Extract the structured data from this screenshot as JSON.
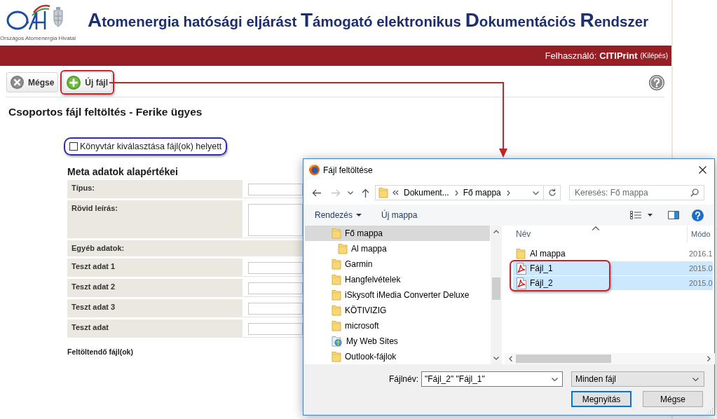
{
  "header": {
    "logo_caption": "Országos Atomenergia Hivatal",
    "title": "Atomenergia hatósági eljárást Támogató elektronikus Dokumentációs Rendszer"
  },
  "user_bar": {
    "label": "Felhasználó:",
    "user": "CITIPrint",
    "logout": "(Kilépés)"
  },
  "toolbar": {
    "buttons": [
      {
        "kind": "cancel",
        "label": "Mégse",
        "framed": false
      },
      {
        "kind": "add",
        "label": "Új fájl",
        "framed": true
      }
    ]
  },
  "page_title": "Csoportos fájl feltöltés - Ferike ügyes",
  "directory_option": {
    "label": "Könyvtár kiválasztása fájl(ok) helyett",
    "checked": false,
    "framed": true
  },
  "meta": {
    "title": "Meta adatok alapértékei",
    "rows": [
      {
        "kind": "input",
        "label": "Típus:"
      },
      {
        "kind": "textarea",
        "label": "Rövid leírás:"
      },
      {
        "kind": "section",
        "label": "Egyéb adatok:"
      },
      {
        "kind": "input",
        "label": "Teszt adat 1"
      },
      {
        "kind": "input",
        "label": "Teszt adat 2"
      },
      {
        "kind": "input",
        "label": "Teszt adat 3"
      },
      {
        "kind": "input",
        "label": "Teszt adat"
      }
    ]
  },
  "upload_label": "Feltöltendő fájl(ok)",
  "dialog": {
    "title": "Fájl feltöltése",
    "history": {
      "back_enabled": true,
      "forward_enabled": false
    },
    "address": [
      "Dokument...",
      "Fő mappa"
    ],
    "search": {
      "placeholder": "Keresés: Fő mappa"
    },
    "commands": [
      {
        "kind": "menu",
        "label": "Rendezés"
      },
      {
        "kind": "plain",
        "label": "Új mappa"
      }
    ],
    "nav": [
      {
        "kind": "folder",
        "label": "Fő mappa",
        "selected": true,
        "children": [
          {
            "kind": "folder",
            "label": "Al mappa",
            "selected": false
          }
        ]
      },
      {
        "kind": "folder",
        "label": "Garmin",
        "selected": false
      },
      {
        "kind": "folder",
        "label": "Hangfelvételek",
        "selected": false
      },
      {
        "kind": "folder",
        "label": "iSkysoft iMedia Converter Deluxe",
        "selected": false
      },
      {
        "kind": "folder",
        "label": "KÖTIVIZIG",
        "selected": false
      },
      {
        "kind": "folder",
        "label": "microsoft",
        "selected": false
      },
      {
        "kind": "web",
        "label": "My Web Sites",
        "selected": false
      },
      {
        "kind": "folder",
        "label": "Outlook-fájlok",
        "selected": false
      }
    ],
    "columns": [
      {
        "label": "Név",
        "sorted": true
      },
      {
        "label": "Módo",
        "sorted": false
      }
    ],
    "files": [
      {
        "kind": "folder",
        "name": "Al mappa",
        "date": "2016.1",
        "selected": false
      },
      {
        "kind": "pdf",
        "name": "Fájl_1",
        "date": "2015.0",
        "selected": true
      },
      {
        "kind": "pdf",
        "name": "Fájl_2",
        "date": "2015.0",
        "selected": true
      }
    ],
    "selection_framed": true,
    "filename": {
      "label": "Fájlnév:",
      "value": "\"Fájl_2\" \"Fájl_1\""
    },
    "filter": {
      "value": "Minden fájl"
    },
    "buttons": [
      {
        "label": "Megnyitás",
        "default": true
      },
      {
        "label": "Mégse",
        "default": false
      }
    ]
  }
}
